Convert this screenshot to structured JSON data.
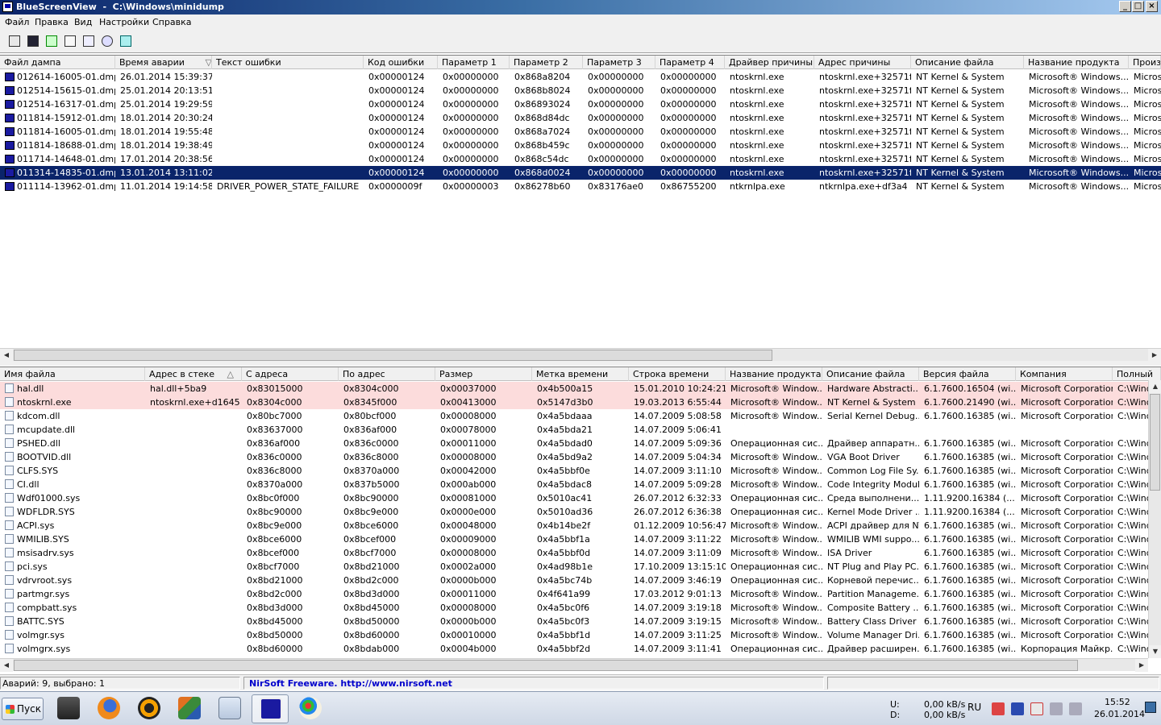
{
  "window": {
    "title": "BlueScreenView  -  C:\\Windows\\minidump",
    "min": "_",
    "max": "□",
    "close": "×"
  },
  "menu": [
    "Файл",
    "Правка",
    "Вид",
    "Настройки",
    "Справка"
  ],
  "toolbar_icons": [
    "html-report-icon",
    "save-icon",
    "refresh-icon",
    "copy-icon",
    "properties-icon",
    "find-icon",
    "exit-icon"
  ],
  "crashes": {
    "columns": [
      "Файл дампа",
      "Время аварии",
      "Текст ошибки",
      "Код ошибки",
      "Параметр 1",
      "Параметр 2",
      "Параметр 3",
      "Параметр 4",
      "Драйвер причины",
      "Адрес причины",
      "Описание файла",
      "Название продукта",
      "Произв"
    ],
    "rows": [
      [
        "012614-16005-01.dmp",
        "26.01.2014 15:39:37",
        "",
        "0x00000124",
        "0x00000000",
        "0x868a8204",
        "0x00000000",
        "0x00000000",
        "ntoskrnl.exe",
        "ntoskrnl.exe+32571f",
        "NT Kernel & System",
        "Microsoft® Windows...",
        "Microso"
      ],
      [
        "012514-15615-01.dmp",
        "25.01.2014 20:13:51",
        "",
        "0x00000124",
        "0x00000000",
        "0x868b8024",
        "0x00000000",
        "0x00000000",
        "ntoskrnl.exe",
        "ntoskrnl.exe+32571f",
        "NT Kernel & System",
        "Microsoft® Windows...",
        "Microso"
      ],
      [
        "012514-16317-01.dmp",
        "25.01.2014 19:29:59",
        "",
        "0x00000124",
        "0x00000000",
        "0x86893024",
        "0x00000000",
        "0x00000000",
        "ntoskrnl.exe",
        "ntoskrnl.exe+32571f",
        "NT Kernel & System",
        "Microsoft® Windows...",
        "Microso"
      ],
      [
        "011814-15912-01.dmp",
        "18.01.2014 20:30:24",
        "",
        "0x00000124",
        "0x00000000",
        "0x868d84dc",
        "0x00000000",
        "0x00000000",
        "ntoskrnl.exe",
        "ntoskrnl.exe+32571f",
        "NT Kernel & System",
        "Microsoft® Windows...",
        "Microso"
      ],
      [
        "011814-16005-01.dmp",
        "18.01.2014 19:55:48",
        "",
        "0x00000124",
        "0x00000000",
        "0x868a7024",
        "0x00000000",
        "0x00000000",
        "ntoskrnl.exe",
        "ntoskrnl.exe+32571f",
        "NT Kernel & System",
        "Microsoft® Windows...",
        "Microso"
      ],
      [
        "011814-18688-01.dmp",
        "18.01.2014 19:38:49",
        "",
        "0x00000124",
        "0x00000000",
        "0x868b459c",
        "0x00000000",
        "0x00000000",
        "ntoskrnl.exe",
        "ntoskrnl.exe+32571f",
        "NT Kernel & System",
        "Microsoft® Windows...",
        "Microso"
      ],
      [
        "011714-14648-01.dmp",
        "17.01.2014 20:38:56",
        "",
        "0x00000124",
        "0x00000000",
        "0x868c54dc",
        "0x00000000",
        "0x00000000",
        "ntoskrnl.exe",
        "ntoskrnl.exe+32571f",
        "NT Kernel & System",
        "Microsoft® Windows...",
        "Microso"
      ],
      [
        "011314-14835-01.dmp",
        "13.01.2014 13:11:02",
        "",
        "0x00000124",
        "0x00000000",
        "0x868d0024",
        "0x00000000",
        "0x00000000",
        "ntoskrnl.exe",
        "ntoskrnl.exe+32571f",
        "NT Kernel & System",
        "Microsoft® Windows...",
        "Microso"
      ],
      [
        "011114-13962-01.dmp",
        "11.01.2014 19:14:58",
        "DRIVER_POWER_STATE_FAILURE",
        "0x0000009f",
        "0x00000003",
        "0x86278b60",
        "0x83176ae0",
        "0x86755200",
        "ntkrnlpa.exe",
        "ntkrnlpa.exe+df3a4",
        "NT Kernel & System",
        "Microsoft® Windows...",
        "Microso"
      ]
    ],
    "selected_index": 7
  },
  "drivers": {
    "columns": [
      "Имя файла",
      "Адрес в стеке",
      "С адреса",
      "По адрес",
      "Размер",
      "Метка времени",
      "Строка времени",
      "Название продукта",
      "Описание файла",
      "Версия файла",
      "Компания",
      "Полный"
    ],
    "rows": [
      [
        "hal.dll",
        "hal.dll+5ba9",
        "0x83015000",
        "0x8304c000",
        "0x00037000",
        "0x4b500a15",
        "15.01.2010 10:24:21",
        "Microsoft® Window...",
        "Hardware Abstracti...",
        "6.1.7600.16504 (wi...",
        "Microsoft Corporation",
        "C:\\Wind"
      ],
      [
        "ntoskrnl.exe",
        "ntoskrnl.exe+d1645",
        "0x8304c000",
        "0x8345f000",
        "0x00413000",
        "0x5147d3b0",
        "19.03.2013 6:55:44",
        "Microsoft® Window...",
        "NT Kernel & System",
        "6.1.7600.21490 (wi...",
        "Microsoft Corporation",
        "C:\\Wind"
      ],
      [
        "kdcom.dll",
        "",
        "0x80bc7000",
        "0x80bcf000",
        "0x00008000",
        "0x4a5bdaaa",
        "14.07.2009 5:08:58",
        "Microsoft® Window...",
        "Serial Kernel Debug...",
        "6.1.7600.16385 (wi...",
        "Microsoft Corporation",
        "C:\\Wind"
      ],
      [
        "mcupdate.dll",
        "",
        "0x83637000",
        "0x836af000",
        "0x00078000",
        "0x4a5bda21",
        "14.07.2009 5:06:41",
        "",
        "",
        "",
        "",
        ""
      ],
      [
        "PSHED.dll",
        "",
        "0x836af000",
        "0x836c0000",
        "0x00011000",
        "0x4a5bdad0",
        "14.07.2009 5:09:36",
        "Операционная сис...",
        "Драйвер аппаратн...",
        "6.1.7600.16385 (wi...",
        "Microsoft Corporation",
        "C:\\Wind"
      ],
      [
        "BOOTVID.dll",
        "",
        "0x836c0000",
        "0x836c8000",
        "0x00008000",
        "0x4a5bd9a2",
        "14.07.2009 5:04:34",
        "Microsoft® Window...",
        "VGA Boot Driver",
        "6.1.7600.16385 (wi...",
        "Microsoft Corporation",
        "C:\\Wind"
      ],
      [
        "CLFS.SYS",
        "",
        "0x836c8000",
        "0x8370a000",
        "0x00042000",
        "0x4a5bbf0e",
        "14.07.2009 3:11:10",
        "Microsoft® Window...",
        "Common Log File Sy...",
        "6.1.7600.16385 (wi...",
        "Microsoft Corporation",
        "C:\\Wind"
      ],
      [
        "CI.dll",
        "",
        "0x8370a000",
        "0x837b5000",
        "0x000ab000",
        "0x4a5bdac8",
        "14.07.2009 5:09:28",
        "Microsoft® Window...",
        "Code Integrity Module",
        "6.1.7600.16385 (wi...",
        "Microsoft Corporation",
        "C:\\Wind"
      ],
      [
        "Wdf01000.sys",
        "",
        "0x8bc0f000",
        "0x8bc90000",
        "0x00081000",
        "0x5010ac41",
        "26.07.2012 6:32:33",
        "Операционная сис...",
        "Среда выполнени...",
        "1.11.9200.16384 (...",
        "Microsoft Corporation",
        "C:\\Wind"
      ],
      [
        "WDFLDR.SYS",
        "",
        "0x8bc90000",
        "0x8bc9e000",
        "0x0000e000",
        "0x5010ad36",
        "26.07.2012 6:36:38",
        "Операционная сис...",
        "Kernel Mode Driver ...",
        "1.11.9200.16384 (...",
        "Microsoft Corporation",
        "C:\\Wind"
      ],
      [
        "ACPI.sys",
        "",
        "0x8bc9e000",
        "0x8bce6000",
        "0x00048000",
        "0x4b14be2f",
        "01.12.2009 10:56:47",
        "Microsoft® Window...",
        "ACPI драйвер для NT",
        "6.1.7600.16385 (wi...",
        "Microsoft Corporation",
        "C:\\Wind"
      ],
      [
        "WMILIB.SYS",
        "",
        "0x8bce6000",
        "0x8bcef000",
        "0x00009000",
        "0x4a5bbf1a",
        "14.07.2009 3:11:22",
        "Microsoft® Window...",
        "WMILIB WMI suppo...",
        "6.1.7600.16385 (wi...",
        "Microsoft Corporation",
        "C:\\Wind"
      ],
      [
        "msisadrv.sys",
        "",
        "0x8bcef000",
        "0x8bcf7000",
        "0x00008000",
        "0x4a5bbf0d",
        "14.07.2009 3:11:09",
        "Microsoft® Window...",
        "ISA Driver",
        "6.1.7600.16385 (wi...",
        "Microsoft Corporation",
        "C:\\Wind"
      ],
      [
        "pci.sys",
        "",
        "0x8bcf7000",
        "0x8bd21000",
        "0x0002a000",
        "0x4ad98b1e",
        "17.10.2009 13:15:10",
        "Операционная сис...",
        "NT Plug and Play PC...",
        "6.1.7600.16385 (wi...",
        "Microsoft Corporation",
        "C:\\Wind"
      ],
      [
        "vdrvroot.sys",
        "",
        "0x8bd21000",
        "0x8bd2c000",
        "0x0000b000",
        "0x4a5bc74b",
        "14.07.2009 3:46:19",
        "Операционная сис...",
        "Корневой перечис...",
        "6.1.7600.16385 (wi...",
        "Microsoft Corporation",
        "C:\\Wind"
      ],
      [
        "partmgr.sys",
        "",
        "0x8bd2c000",
        "0x8bd3d000",
        "0x00011000",
        "0x4f641a99",
        "17.03.2012 9:01:13",
        "Microsoft® Window...",
        "Partition Manageme...",
        "6.1.7600.16385 (wi...",
        "Microsoft Corporation",
        "C:\\Wind"
      ],
      [
        "compbatt.sys",
        "",
        "0x8bd3d000",
        "0x8bd45000",
        "0x00008000",
        "0x4a5bc0f6",
        "14.07.2009 3:19:18",
        "Microsoft® Window...",
        "Composite Battery ...",
        "6.1.7600.16385 (wi...",
        "Microsoft Corporation",
        "C:\\Wind"
      ],
      [
        "BATTC.SYS",
        "",
        "0x8bd45000",
        "0x8bd50000",
        "0x0000b000",
        "0x4a5bc0f3",
        "14.07.2009 3:19:15",
        "Microsoft® Window...",
        "Battery Class Driver",
        "6.1.7600.16385 (wi...",
        "Microsoft Corporation",
        "C:\\Wind"
      ],
      [
        "volmgr.sys",
        "",
        "0x8bd50000",
        "0x8bd60000",
        "0x00010000",
        "0x4a5bbf1d",
        "14.07.2009 3:11:25",
        "Microsoft® Window...",
        "Volume Manager Dri...",
        "6.1.7600.16385 (wi...",
        "Microsoft Corporation",
        "C:\\Wind"
      ],
      [
        "volmgrx.sys",
        "",
        "0x8bd60000",
        "0x8bdab000",
        "0x0004b000",
        "0x4a5bbf2d",
        "14.07.2009 3:11:41",
        "Операционная сис...",
        "Драйвер расширен...",
        "6.1.7600.16385 (wi...",
        "Корпорация Майкр...",
        "C:\\Wind"
      ]
    ],
    "highlighted_count": 2
  },
  "status": {
    "count": "Аварий: 9, выбрано: 1",
    "nirsoft": "NirSoft Freeware.  http://www.nirsoft.net"
  },
  "taskbar": {
    "start_label": "Пуск",
    "apps": [
      "explorer-icon",
      "firefox-icon",
      "avast-icon",
      "office-icon",
      "calculator-icon",
      "bluescreenview-icon",
      "paint-icon"
    ],
    "active_app_index": 5,
    "net_upload_label": "U:",
    "net_download_label": "D:",
    "net_upload": "0,00 kB/s",
    "net_download": "0,00 kB/s",
    "lang": "RU",
    "time": "15:52",
    "date": "26.01.2014"
  },
  "colors": {
    "selection": "#0a246a",
    "highlight_row": "#fcdcdc",
    "link": "#0000cc"
  }
}
